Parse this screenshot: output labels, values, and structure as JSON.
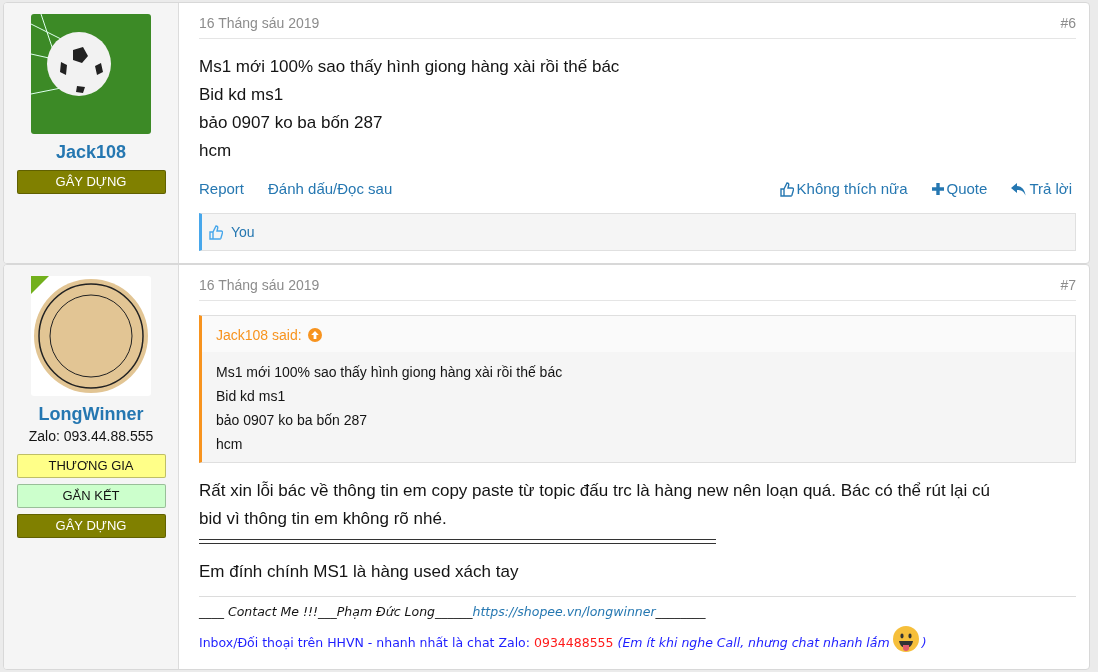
{
  "posts": [
    {
      "author": {
        "name": "Jack108",
        "avatar": {
          "kind": "photo"
        },
        "online": false,
        "badges": [
          {
            "label": "GÂY DỰNG",
            "color": "#808000"
          }
        ]
      },
      "date": "16 Tháng sáu 2019",
      "number": "#6",
      "body": [
        {
          "kind": "paragraph",
          "lines": [
            "Ms1 mới 100% sao thấy hình giong hàng xài rồi thế bác",
            "Bid kd ms1",
            "bảo 0907 ko ba bốn 287",
            "hcm"
          ]
        }
      ],
      "actions_left": [
        "Report",
        "Đánh dấu/Đọc sau"
      ],
      "actions_right": [
        {
          "kind": "like",
          "label": "Không thích nữa"
        },
        {
          "kind": "quote",
          "label": "Quote"
        },
        {
          "kind": "reply",
          "label": "Trả lời"
        }
      ],
      "likes": "You"
    },
    {
      "author": {
        "name": "LongWinner",
        "avatar": {
          "kind": "logo"
        },
        "online": true,
        "extra": "Zalo: 093.44.88.555",
        "badges": [
          {
            "label": "THƯƠNG GIA",
            "color": "#ffff88"
          },
          {
            "label": "GẮN KẾT",
            "color": "#ccffcc"
          },
          {
            "label": "GÂY DỰNG",
            "color": "#808000"
          }
        ]
      },
      "date": "16 Tháng sáu 2019",
      "number": "#7",
      "quote": {
        "attribution": "Jack108 said:",
        "lines": [
          "Ms1 mới 100% sao thấy hình giong hàng xài rồi thế bác",
          "Bid kd ms1",
          "bảo 0907 ko ba bốn 287",
          "hcm"
        ]
      },
      "body": [
        {
          "kind": "paragraph",
          "lines": [
            "Rất xin lỗi bác về thông tin em copy paste từ topic đấu trc là hàng new nên loạn quá. Bác có thể rút lại cú",
            "bid vì thông tin em không rõ nhé."
          ]
        },
        {
          "kind": "rule"
        },
        {
          "kind": "paragraph",
          "lines": [
            "Em đính chính MS1 là hàng used xách tay"
          ]
        }
      ],
      "signature": [
        [
          {
            "kind": "text",
            "text": "____ Contact Me !!!___Phạm Đức Long______"
          },
          {
            "kind": "link",
            "text": "https://shopee.vn/longwinner"
          },
          {
            "kind": "text",
            "text": "________"
          }
        ],
        [
          {
            "kind": "info",
            "text": "Inbox/Đối thoại trên HHVN - nhanh nhất là chat Zalo:"
          },
          {
            "kind": "phone",
            "text": "0934488555"
          },
          {
            "kind": "note",
            "text": "(Em ít khi nghe Call, nhưng chat nhanh lắm"
          },
          {
            "kind": "emoji"
          },
          {
            "kind": "note",
            "text": ")"
          }
        ]
      ]
    }
  ]
}
